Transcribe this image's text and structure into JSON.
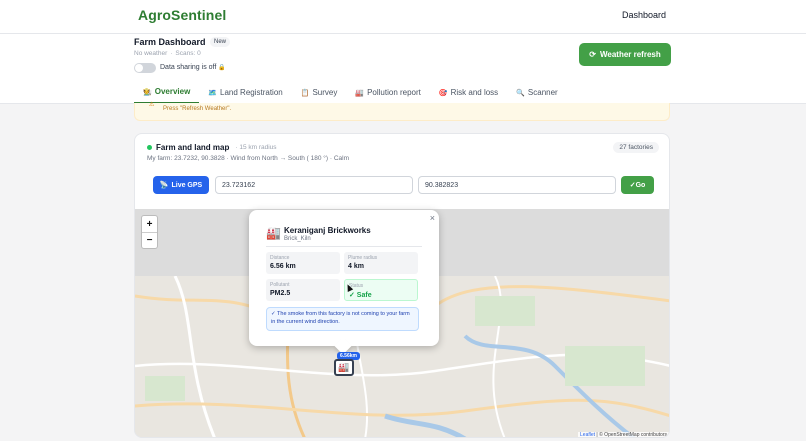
{
  "app": {
    "logo": "AgroSentinel",
    "nav_dashboard": "Dashboard"
  },
  "header": {
    "title": "Farm Dashboard",
    "badge": "New",
    "weather_status": "No weather",
    "scans": "Scans: 0",
    "sharing_label": "Data sharing is off",
    "weather_button": "Weather refresh"
  },
  "tabs": [
    {
      "icon": "🧑‍🌾",
      "label": "Overview"
    },
    {
      "icon": "🗺️",
      "label": "Land Registration"
    },
    {
      "icon": "📋",
      "label": "Survey"
    },
    {
      "icon": "🏭",
      "label": "Pollution report"
    },
    {
      "icon": "🎯",
      "label": "Risk and loss"
    },
    {
      "icon": "🔍",
      "label": "Scanner"
    }
  ],
  "notice": {
    "text": "Press \"Refresh Weather\"."
  },
  "map_card": {
    "title": "Farm and land map",
    "radius": "· 15 km radius",
    "farm_line": "My farm: 23.7232, 90.3828 · Wind from North → South ( 180 °) · Calm",
    "factories": "27 factories",
    "gps_button": "Live GPS",
    "lat_value": "23.723162",
    "lon_value": "90.382823",
    "go_button": "✓Go",
    "attribution_leaflet": "Leaflet",
    "attribution_osm": "| © OpenStreetMap contributors"
  },
  "popup": {
    "icon": "🏭",
    "title": "Keraniganj Brickworks",
    "subtitle": "Brick_Kiln",
    "distance_label": "Distance",
    "distance_value": "6.56 km",
    "plume_label": "Plume radius",
    "plume_value": "4 km",
    "pollutant_label": "Pollutant",
    "pollutant_value": "PM2.5",
    "status_label": "Status",
    "status_value": "✓ Safe",
    "info": "✓ The smoke from this factory is not coming to your farm in the current wind direction."
  },
  "marker": {
    "label": "6.56km",
    "icon": "🏭"
  }
}
